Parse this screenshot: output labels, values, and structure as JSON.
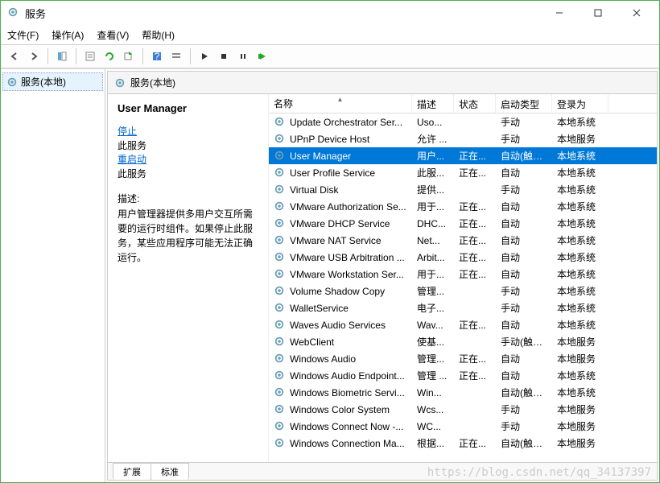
{
  "window": {
    "title": "服务"
  },
  "menu": {
    "file": "文件(F)",
    "action": "操作(A)",
    "view": "查看(V)",
    "help": "帮助(H)"
  },
  "tree": {
    "root": "服务(本地)"
  },
  "innerHeader": "服务(本地)",
  "detail": {
    "name": "User Manager",
    "stop_prefix": "停止",
    "stop_suffix": "此服务",
    "restart_prefix": "重启动",
    "restart_suffix": "此服务",
    "desc_label": "描述:",
    "desc_text": "用户管理器提供多用户交互所需要的运行时组件。如果停止此服务，某些应用程序可能无法正确运行。"
  },
  "cols": {
    "name": "名称",
    "desc": "描述",
    "stat": "状态",
    "start": "启动类型",
    "logon": "登录为"
  },
  "services": [
    {
      "name": "Update Orchestrator Ser...",
      "desc": "Uso...",
      "stat": "",
      "start": "手动",
      "logon": "本地系统",
      "sel": false
    },
    {
      "name": "UPnP Device Host",
      "desc": "允许 ...",
      "stat": "",
      "start": "手动",
      "logon": "本地服务",
      "sel": false
    },
    {
      "name": "User Manager",
      "desc": "用户...",
      "stat": "正在...",
      "start": "自动(触发...",
      "logon": "本地系统",
      "sel": true
    },
    {
      "name": "User Profile Service",
      "desc": "此服...",
      "stat": "正在...",
      "start": "自动",
      "logon": "本地系统",
      "sel": false
    },
    {
      "name": "Virtual Disk",
      "desc": "提供...",
      "stat": "",
      "start": "手动",
      "logon": "本地系统",
      "sel": false
    },
    {
      "name": "VMware Authorization Se...",
      "desc": "用于...",
      "stat": "正在...",
      "start": "自动",
      "logon": "本地系统",
      "sel": false
    },
    {
      "name": "VMware DHCP Service",
      "desc": "DHC...",
      "stat": "正在...",
      "start": "自动",
      "logon": "本地系统",
      "sel": false
    },
    {
      "name": "VMware NAT Service",
      "desc": "Net...",
      "stat": "正在...",
      "start": "自动",
      "logon": "本地系统",
      "sel": false
    },
    {
      "name": "VMware USB Arbitration ...",
      "desc": "Arbit...",
      "stat": "正在...",
      "start": "自动",
      "logon": "本地系统",
      "sel": false
    },
    {
      "name": "VMware Workstation Ser...",
      "desc": "用于...",
      "stat": "正在...",
      "start": "自动",
      "logon": "本地系统",
      "sel": false
    },
    {
      "name": "Volume Shadow Copy",
      "desc": "管理...",
      "stat": "",
      "start": "手动",
      "logon": "本地系统",
      "sel": false
    },
    {
      "name": "WalletService",
      "desc": "电子...",
      "stat": "",
      "start": "手动",
      "logon": "本地系统",
      "sel": false
    },
    {
      "name": "Waves Audio Services",
      "desc": "Wav...",
      "stat": "正在...",
      "start": "自动",
      "logon": "本地系统",
      "sel": false
    },
    {
      "name": "WebClient",
      "desc": "使基...",
      "stat": "",
      "start": "手动(触发...",
      "logon": "本地服务",
      "sel": false
    },
    {
      "name": "Windows Audio",
      "desc": "管理...",
      "stat": "正在...",
      "start": "自动",
      "logon": "本地服务",
      "sel": false
    },
    {
      "name": "Windows Audio Endpoint...",
      "desc": "管理 ...",
      "stat": "正在...",
      "start": "自动",
      "logon": "本地系统",
      "sel": false
    },
    {
      "name": "Windows Biometric Servi...",
      "desc": "Win...",
      "stat": "",
      "start": "自动(触发...",
      "logon": "本地系统",
      "sel": false
    },
    {
      "name": "Windows Color System",
      "desc": "Wcs...",
      "stat": "",
      "start": "手动",
      "logon": "本地服务",
      "sel": false
    },
    {
      "name": "Windows Connect Now -...",
      "desc": "WC...",
      "stat": "",
      "start": "手动",
      "logon": "本地服务",
      "sel": false
    },
    {
      "name": "Windows Connection Ma...",
      "desc": "根据...",
      "stat": "正在...",
      "start": "自动(触发...",
      "logon": "本地服务",
      "sel": false
    }
  ],
  "tabs": {
    "ext": "扩展",
    "std": "标准"
  },
  "watermark": "https://blog.csdn.net/qq_34137397"
}
